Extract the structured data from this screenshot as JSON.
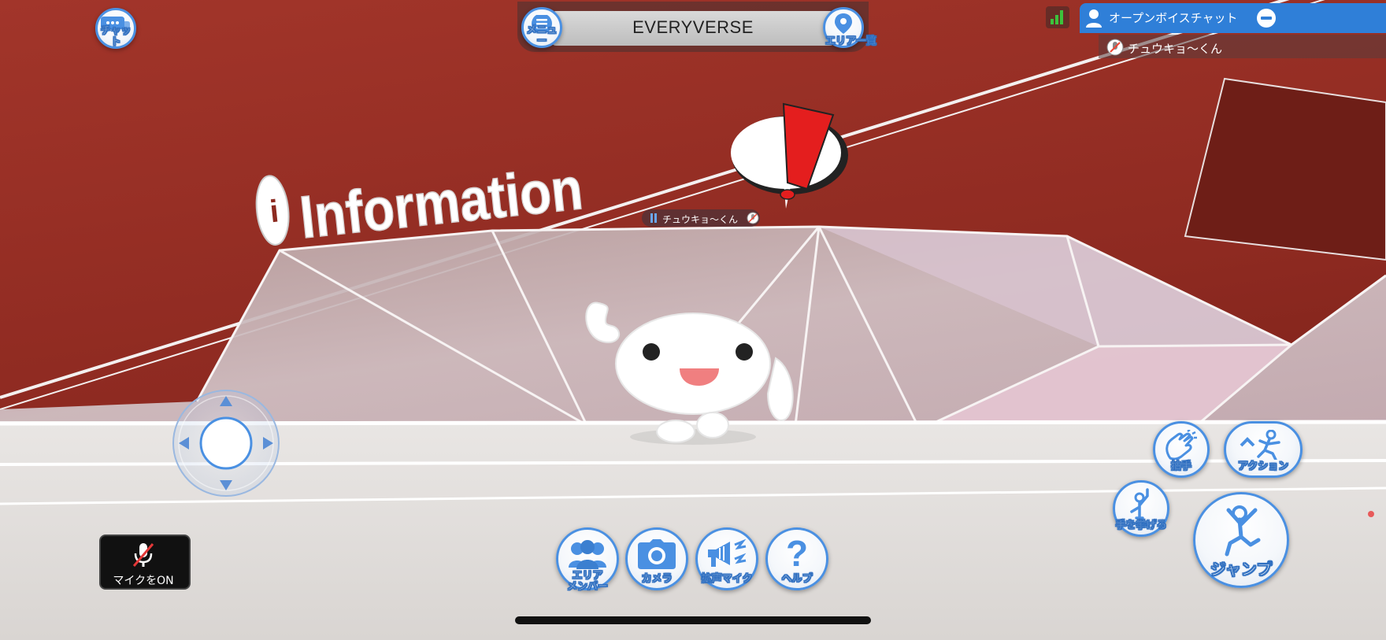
{
  "app": {
    "title": "EVERYVERSE"
  },
  "top_left": {
    "chat_label": "チャット"
  },
  "top_bar": {
    "menu_label": "メニュー",
    "area_list_label": "エリア一覧"
  },
  "voice_chat": {
    "title": "オープンボイスチャット",
    "member_name": "チュウキョ〜くん"
  },
  "scene": {
    "sign_text": "Information",
    "player_name": "チュウキョ〜くん",
    "alert_glyph": "!"
  },
  "mic": {
    "label": "マイクをON"
  },
  "bottom_bar": {
    "items": [
      {
        "label": "エリア\nメンバー",
        "icon": "members-icon"
      },
      {
        "label": "カメラ",
        "icon": "camera-icon"
      },
      {
        "label": "拡声マイク",
        "icon": "megaphone-icon"
      },
      {
        "label": "ヘルプ",
        "icon": "help-icon"
      }
    ]
  },
  "actions": {
    "clap_label": "拍手",
    "action_label": "アクション",
    "raise_hand_label": "手を挙げる",
    "jump_label": "ジャンプ"
  },
  "colors": {
    "accent": "#4a90e2",
    "wall": "#8c2a20",
    "signal": "#3cc23c",
    "alert": "#e41e1e"
  }
}
